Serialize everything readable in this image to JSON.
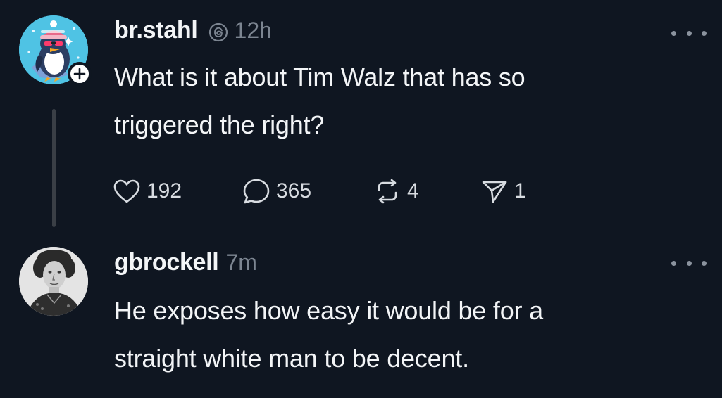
{
  "thread": {
    "original_post": {
      "username": "br.stahl",
      "time": "12h",
      "text_line1": "What is it about Tim Walz that has so",
      "text_line2": "triggered the right?",
      "likes": "192",
      "replies": "365",
      "reposts": "4",
      "shares": "1",
      "icons": {
        "verified": "threads-badge-icon",
        "follow": "plus-icon",
        "like": "heart-icon",
        "reply": "speech-bubble-icon",
        "repost": "repost-icon",
        "share": "paper-plane-icon",
        "more": "ellipsis-icon"
      }
    },
    "reply_post": {
      "username": "gbrockell",
      "time": "7m",
      "text_line1": "He exposes how easy it would be for a",
      "text_line2": "straight white man to be decent.",
      "icons": {
        "more": "ellipsis-icon"
      }
    }
  },
  "colors": {
    "background": "#0f1621",
    "text_primary": "#f3f5f7",
    "text_secondary": "#7c8591",
    "thread_line": "#3a3f46",
    "avatar1_bg": "#4fc3e4"
  }
}
